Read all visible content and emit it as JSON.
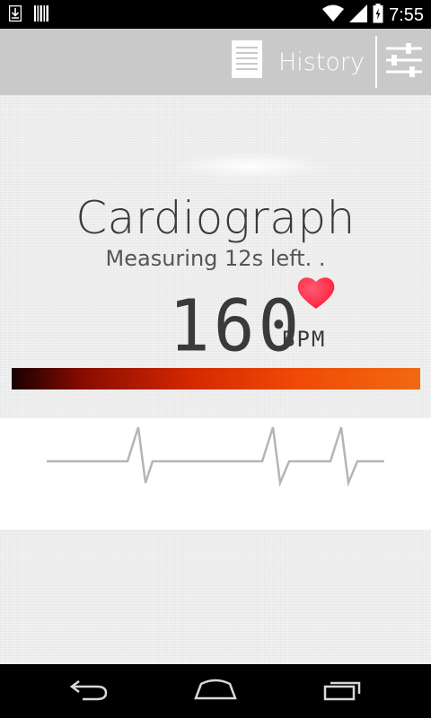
{
  "status_bar": {
    "time": "7:55",
    "left_icons": [
      "download-icon",
      "barcode-icon"
    ],
    "right_icons": [
      "wifi-icon",
      "signal-icon",
      "battery-icon"
    ]
  },
  "action_bar": {
    "history_label": "History",
    "history_icon": "list-icon",
    "settings_icon": "sliders-icon"
  },
  "main": {
    "title": "Cardiograph",
    "status_text": "Measuring 12s left. .",
    "bpm_value": "160",
    "bpm_unit": "BPM",
    "heart_color": "#ff2a4a"
  },
  "nav_bar": {
    "back_icon": "back-icon",
    "home_icon": "home-icon",
    "recents_icon": "recents-icon"
  }
}
